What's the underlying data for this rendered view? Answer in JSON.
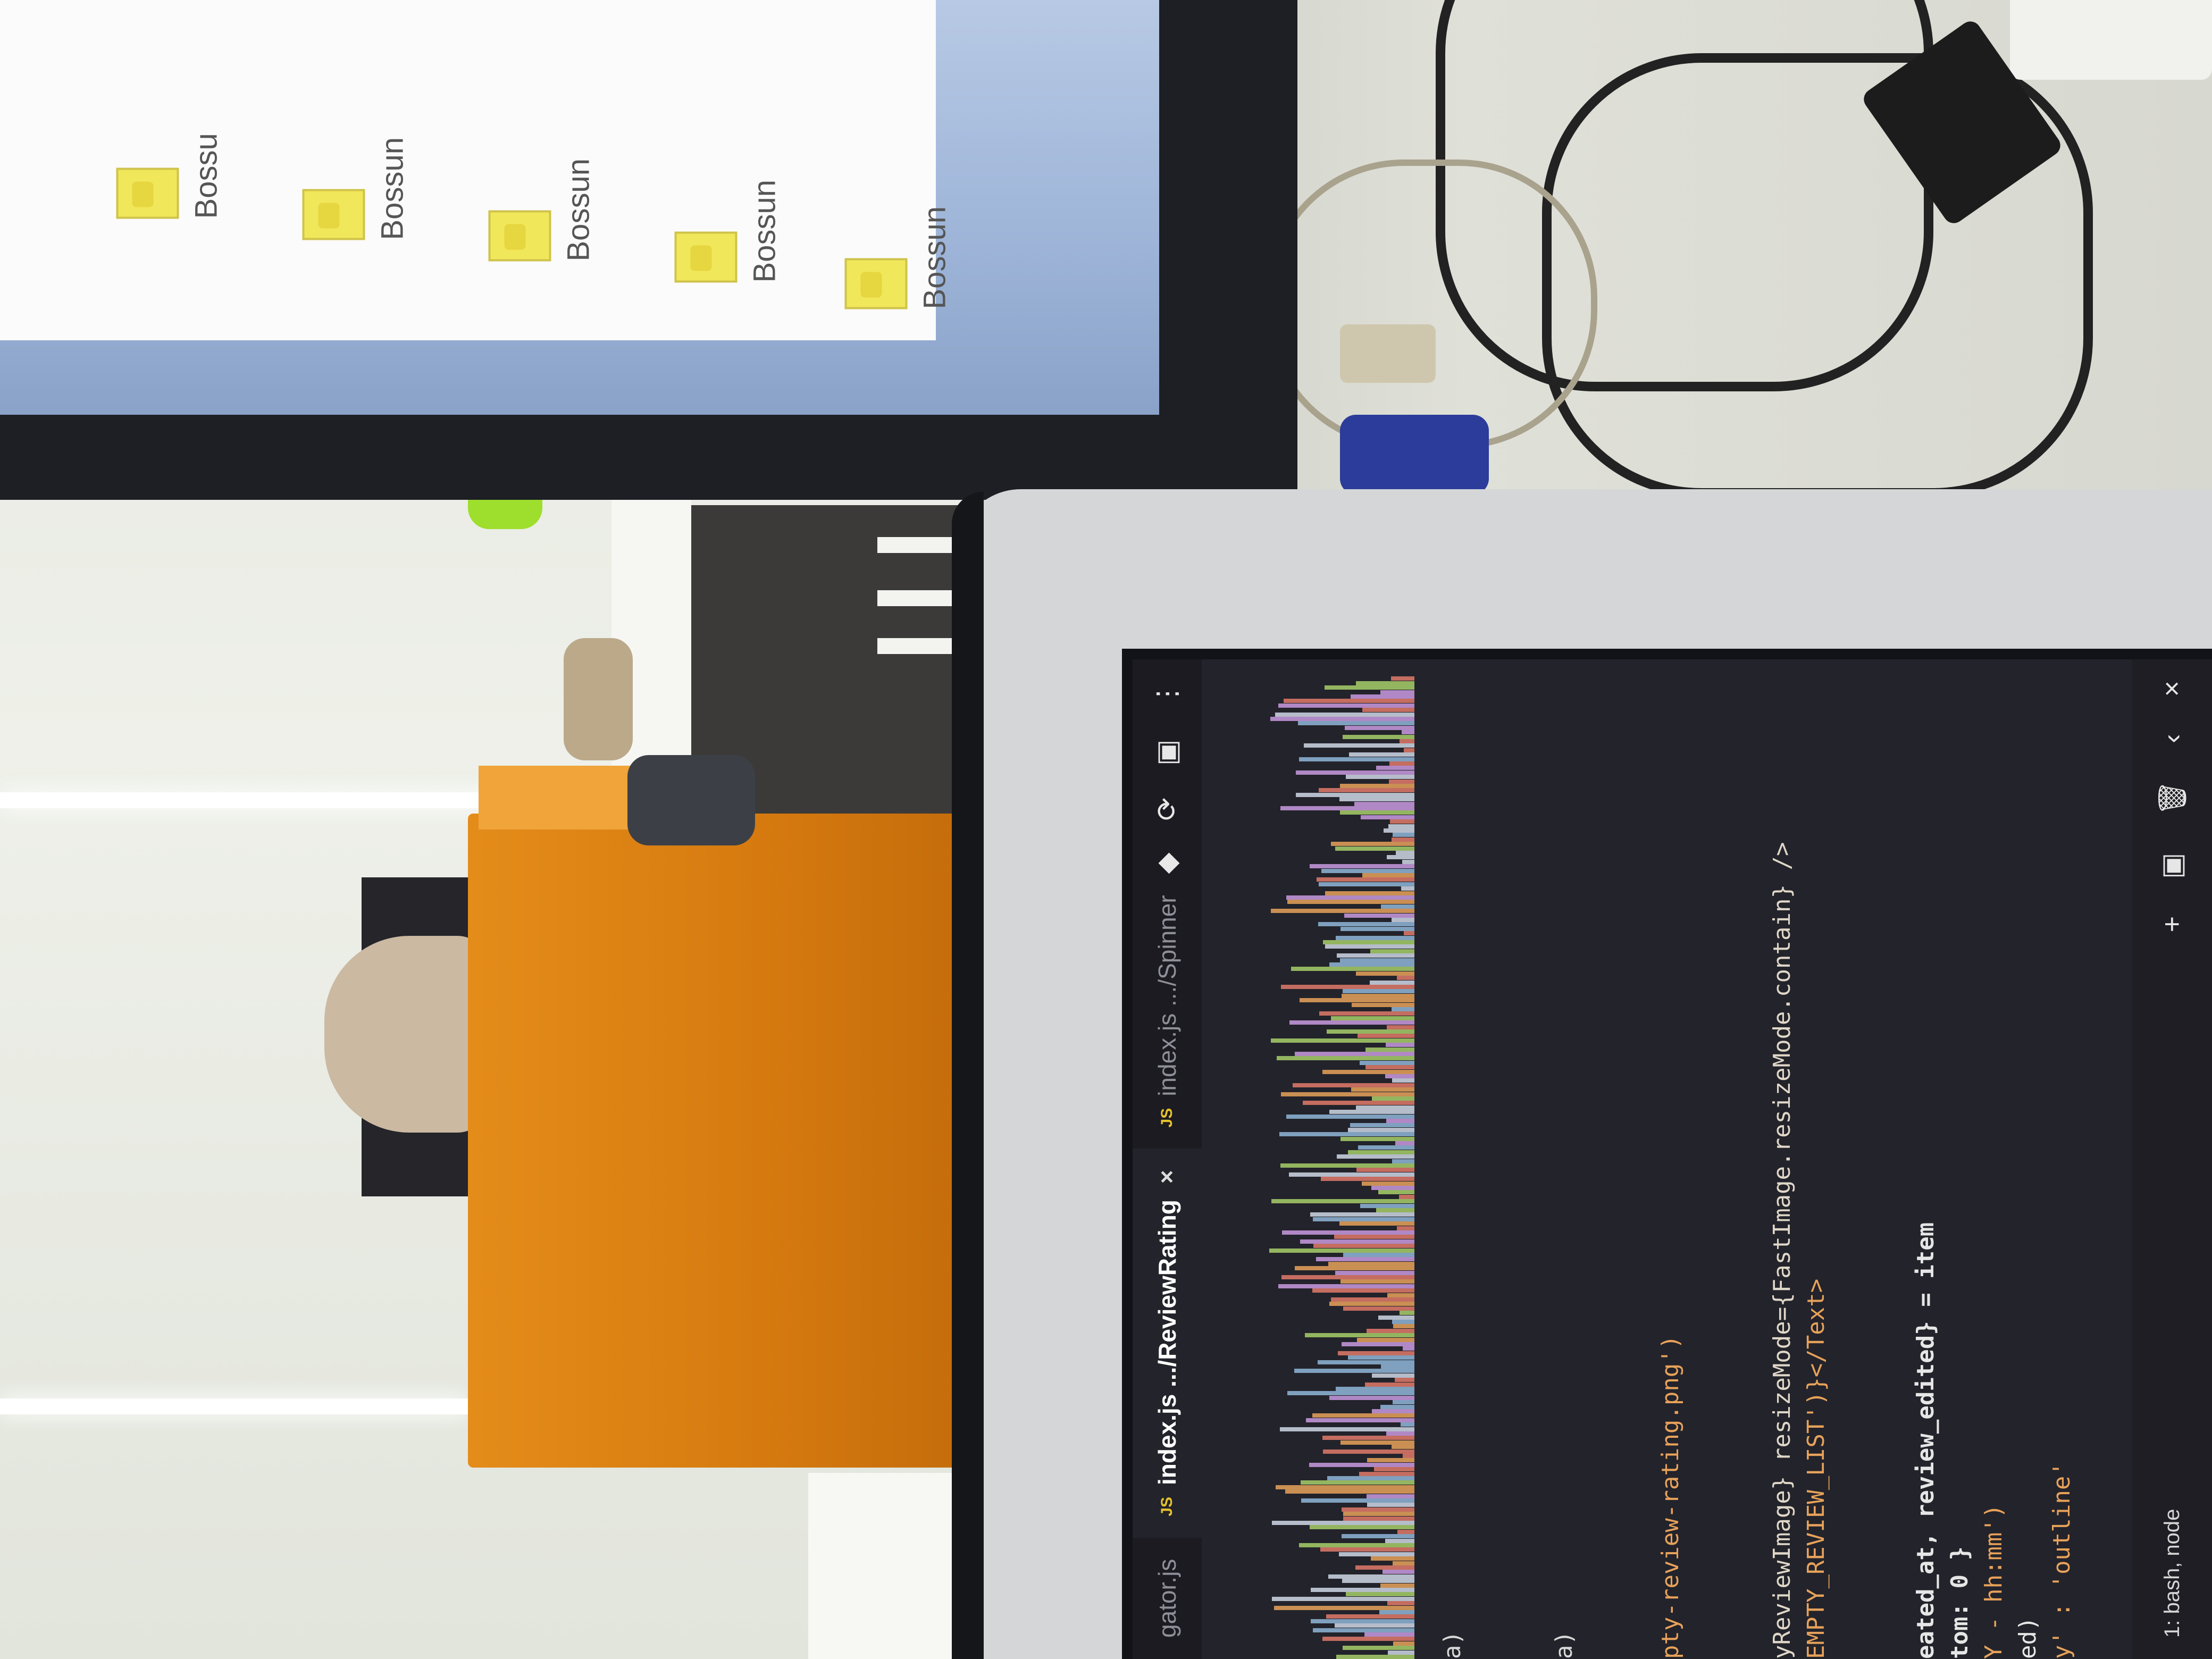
{
  "monitor": {
    "files": [
      {
        "name": "Bossu"
      },
      {
        "name": "Bossun"
      },
      {
        "name": "Bossun"
      },
      {
        "name": "Bossun"
      },
      {
        "name": "Bossun"
      }
    ]
  },
  "editor": {
    "tabs": [
      {
        "icon": "JS",
        "label": "gator.js",
        "active": false
      },
      {
        "icon": "JS",
        "label": "index.js .../ReviewRating",
        "active": true
      },
      {
        "icon": "JS",
        "label": "index.js .../Spinner",
        "active": false
      }
    ],
    "close_glyph": "×",
    "toolbar_icons": [
      "⋮",
      "▣",
      "⟳",
      "◆"
    ],
    "code_lines": [
      {
        "text": "a)"
      },
      {
        "text": "a)"
      },
      {
        "text": "pty-review-rating.png')"
      },
      {
        "text": "yReviewImage} resizeMode={FastImage.resizeMode.contain} />"
      },
      {
        "text": "EMPTY_REVIEW_LIST')}</Text>"
      },
      {
        "text": "eated_at, review_edited} = item"
      },
      {
        "text": "tom: 0 }"
      },
      {
        "text": "Y - hh:mm')"
      },
      {
        "text": "ed)"
      },
      {
        "text": "y' : 'outline'"
      }
    ],
    "terminal_label": "1: bash, node",
    "terminal_icons": [
      "×",
      "‹",
      "🗑",
      "▣",
      "+"
    ]
  },
  "colors": {
    "editor_bg": "#23232b",
    "tab_bar_bg": "#1b1b21",
    "string": "#e7a25a",
    "jsx_text": "#5fd7a8",
    "js_badge": "#e5c22b"
  }
}
